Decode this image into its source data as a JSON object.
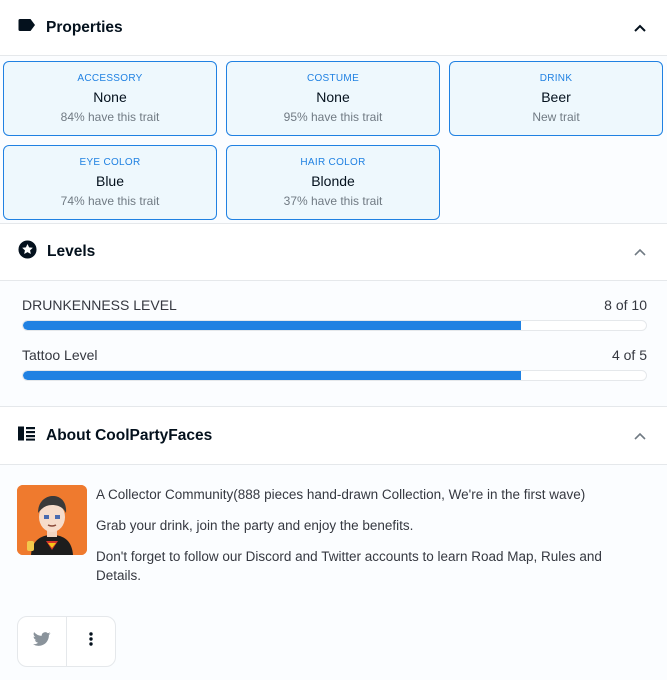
{
  "properties": {
    "title": "Properties",
    "traits": [
      {
        "type": "ACCESSORY",
        "value": "None",
        "rarity": "84% have this trait"
      },
      {
        "type": "COSTUME",
        "value": "None",
        "rarity": "95% have this trait"
      },
      {
        "type": "DRINK",
        "value": "Beer",
        "rarity": "New trait"
      },
      {
        "type": "EYE COLOR",
        "value": "Blue",
        "rarity": "74% have this trait"
      },
      {
        "type": "HAIR COLOR",
        "value": "Blonde",
        "rarity": "37% have this trait"
      }
    ]
  },
  "levels": {
    "title": "Levels",
    "items": [
      {
        "name": "DRUNKENNESS LEVEL",
        "value_text": "8 of 10",
        "fraction": 0.8
      },
      {
        "name": "Tattoo Level",
        "value_text": "4 of 5",
        "fraction": 0.8
      }
    ]
  },
  "about": {
    "title": "About CoolPartyFaces",
    "paragraphs": [
      "A Collector Community(888 pieces hand-drawn Collection, We're in the first wave)",
      "Grab your drink, join the party and enjoy the benefits.",
      "Don't forget to follow our Discord and Twitter accounts to learn Road Map, Rules and Details."
    ]
  },
  "colors": {
    "accent": "#2081e2",
    "trait_bg": "#eef8fd",
    "avatar_bg": "#ef7a2e"
  },
  "icons": {
    "properties": "tag-icon",
    "levels": "star-circle-icon",
    "about": "list-icon",
    "collapse": "chevron-up-icon",
    "twitter": "twitter-icon",
    "more": "more-vertical-icon"
  }
}
